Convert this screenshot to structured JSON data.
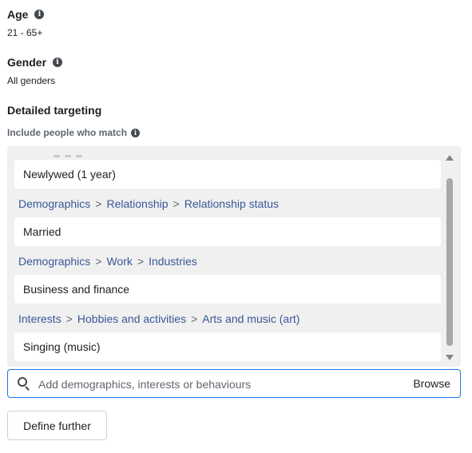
{
  "age": {
    "title": "Age",
    "value": "21 - 65+",
    "info_icon": "info-icon"
  },
  "gender": {
    "title": "Gender",
    "value": "All genders",
    "info_icon": "info-icon"
  },
  "detailed_targeting": {
    "title": "Detailed targeting",
    "include_label": "Include people who match",
    "entries": [
      {
        "kind": "item",
        "label": "Newlywed (1 year)"
      },
      {
        "kind": "path",
        "parts": [
          "Demographics",
          "Relationship",
          "Relationship status"
        ]
      },
      {
        "kind": "item",
        "label": "Married"
      },
      {
        "kind": "path",
        "parts": [
          "Demographics",
          "Work",
          "Industries"
        ]
      },
      {
        "kind": "item",
        "label": "Business and finance"
      },
      {
        "kind": "path",
        "parts": [
          "Interests",
          "Hobbies and activities",
          "Arts and music (art)"
        ]
      },
      {
        "kind": "item",
        "label": "Singing (music)"
      }
    ],
    "path_separator": ">"
  },
  "search": {
    "placeholder": "Add demographics, interests or behaviours",
    "value": "",
    "browse_label": "Browse",
    "icon": "search-icon"
  },
  "define_further": {
    "label": "Define further"
  },
  "colors": {
    "path_link": "#385898",
    "focus_border": "#1877f2",
    "panel_bg": "#f0f0f0"
  }
}
